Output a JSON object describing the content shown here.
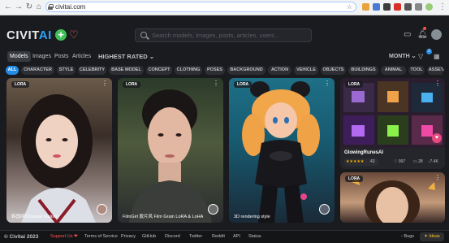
{
  "browser": {
    "url": "civitai.com"
  },
  "header": {
    "logo_main": "CIVIT",
    "logo_ai": "AI",
    "search_placeholder": "Search models, images, posts, articles, users..."
  },
  "filters": {
    "tabs": [
      "Models",
      "Images",
      "Posts",
      "Articles"
    ],
    "active_tab": "Models",
    "sort": "HIGHEST RATED",
    "period": "MONTH",
    "filter_badge": "2"
  },
  "tags": [
    "ALL",
    "CHARACTER",
    "STYLE",
    "CELEBRITY",
    "BASE MODEL",
    "CONCEPT",
    "CLOTHING",
    "POSES",
    "BACKGROUND",
    "ACTION",
    "VEHICLE",
    "OBJECTS",
    "BUILDINGS",
    "ANIMAL",
    "TOOL",
    "ASSET"
  ],
  "cards": [
    {
      "badge": "LORA",
      "title": "韩国网红Kawaii realistic"
    },
    {
      "badge": "LORA",
      "title": "FilmGirl 胶片风 Film Grain LoRA & LoHA"
    },
    {
      "badge": "LORA",
      "title": "3D rendering style"
    },
    {
      "badge": "LORA",
      "title": "GlowingRunesAI",
      "rating": "★★★★★",
      "rating_count": "43",
      "stat1": "997",
      "stat2": "28",
      "stat3": "7.4K"
    },
    {
      "badge": "LORA",
      "title": ""
    }
  ],
  "footer": {
    "copyright": "© Civitai 2023",
    "links": [
      "Support Us ❤",
      "Terms of Service",
      "Privacy",
      "GitHub",
      "Discord",
      "Twitter",
      "Reddit",
      "API",
      "Status"
    ],
    "bugs": "Bugs",
    "ideas": "Ideas"
  },
  "colors": {
    "accent": "#228be6",
    "brand_ai": "#2aa3ff",
    "background": "#1a1b1e"
  }
}
